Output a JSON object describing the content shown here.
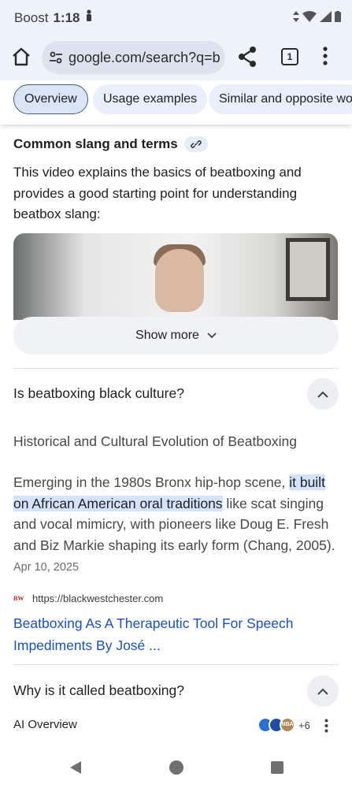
{
  "status_bar": {
    "carrier": "Boost",
    "time": "1:18"
  },
  "browser": {
    "url": "google.com/search?q=b",
    "tab_count": "1"
  },
  "chips": [
    {
      "label": "Overview",
      "active": true
    },
    {
      "label": "Usage examples",
      "active": false
    },
    {
      "label": "Similar and opposite wo",
      "active": false
    }
  ],
  "slang_section": {
    "title": "Common slang and terms",
    "description": "This video explains the basics of beatboxing and provides a good starting point for understanding beatbox slang:",
    "show_more_label": "Show more"
  },
  "faq": [
    {
      "question": "Is beatboxing black culture?",
      "expanded": true,
      "answer_heading": "Historical and Cultural Evolution of Beatboxing",
      "answer_before": "Emerging in the 1980s Bronx hip-hop scene, ",
      "answer_highlight": "it built on African American oral traditions",
      "answer_after": " like scat singing and vocal mimicry, with pioneers like Doug E. Fresh and Biz Markie shaping its early form (Chang, 2005). ",
      "date": "Apr 10, 2025",
      "source_logo_text": "BW",
      "source_url": "https://blackwestchester.com",
      "source_title": "Beatboxing As A Therapeutic Tool For Speech Impediments By José ..."
    },
    {
      "question": "Why is it called beatboxing?",
      "expanded": true,
      "ai_label": "AI Overview",
      "ai_source_badge": "NBA",
      "ai_source_count": "+6"
    }
  ],
  "colors": {
    "toolbar_bg": "#eef2fa",
    "chip_bg": "#e8eefa",
    "link": "#1a4fbf",
    "highlight": "#d3e3fd"
  }
}
